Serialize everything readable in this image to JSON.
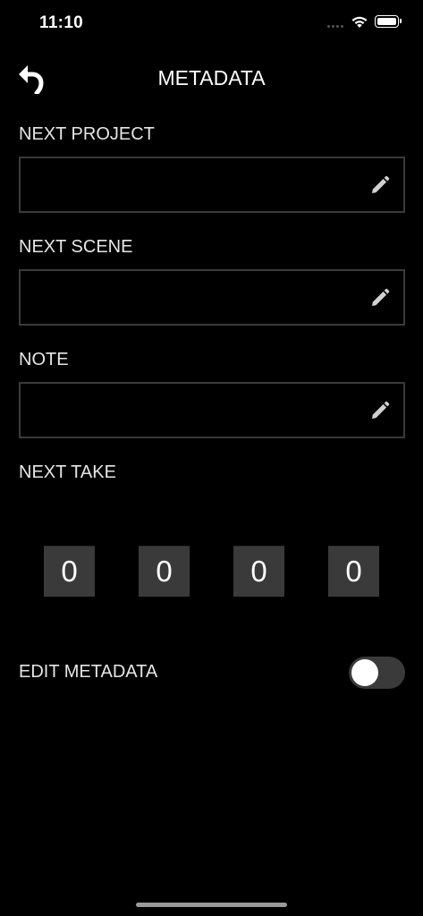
{
  "status_bar": {
    "time": "11:10"
  },
  "header": {
    "title": "METADATA"
  },
  "fields": {
    "project": {
      "label": "NEXT PROJECT",
      "value": ""
    },
    "scene": {
      "label": "NEXT SCENE",
      "value": ""
    },
    "note": {
      "label": "NOTE",
      "value": ""
    }
  },
  "take": {
    "label": "NEXT TAKE",
    "digits": [
      "0",
      "0",
      "0",
      "0"
    ]
  },
  "edit_metadata": {
    "label": "EDIT METADATA",
    "enabled": false
  },
  "colors": {
    "background": "#000000",
    "field_border": "#3a3a3a",
    "digit_bg": "#3a3a3a",
    "text": "#e6e6e6"
  },
  "icons": {
    "back": "undo-arrow-icon",
    "edit": "pencil-icon"
  }
}
